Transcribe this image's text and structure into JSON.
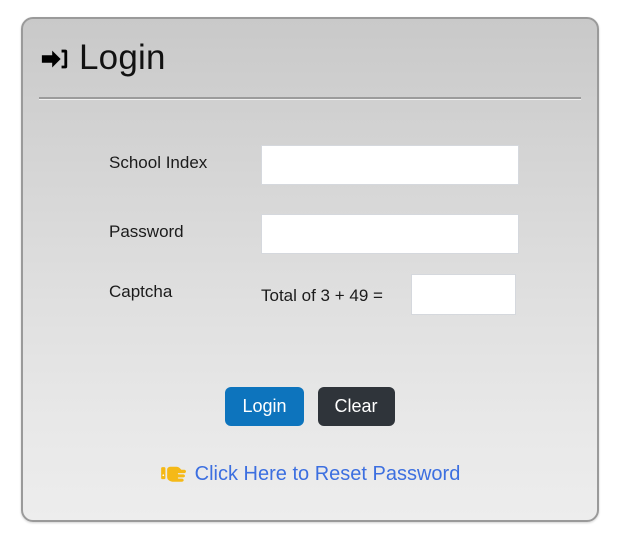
{
  "panel": {
    "header": {
      "icon": "sign-in-arrow-icon",
      "title": "Login"
    },
    "fields": {
      "school_index": {
        "label": "School Index",
        "value": "",
        "placeholder": ""
      },
      "password": {
        "label": "Password",
        "value": "",
        "placeholder": ""
      },
      "captcha": {
        "label": "Captcha",
        "question": "Total of 3 + 49 =",
        "operand_a": "3",
        "operand_b": "49",
        "value": "",
        "placeholder": ""
      }
    },
    "buttons": {
      "login": "Login",
      "clear": "Clear"
    },
    "reset": {
      "icon": "pointing-hand-right-icon",
      "link_text": "Click Here to Reset Password"
    }
  },
  "colors": {
    "login_button": "#0d74bd",
    "clear_button": "#2f343a",
    "link": "#3c6fe0",
    "hand_icon": "#f5b917",
    "panel_border": "#9a9a9a",
    "panel_top": "#c9c9c9",
    "panel_bottom": "#ededed"
  }
}
